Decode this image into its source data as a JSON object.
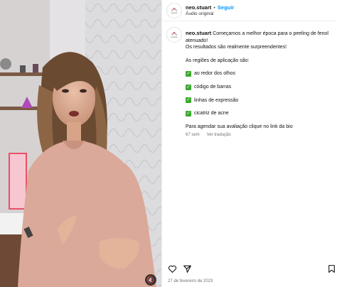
{
  "header": {
    "username": "neo.stuart",
    "separator": "•",
    "follow_label": "Seguir",
    "audio_label": "Áudio original"
  },
  "caption": {
    "username": "neo.stuart",
    "text": "Começamos a melhor época para o peeling de fenol atenuado!",
    "line2": "Os resultados são realmente surpreendentes!",
    "regions_intro": "As regiões de aplicação são:",
    "items": [
      "ao redor dos olhos",
      "código de barras",
      "linhas de expressão",
      "cicatriz de acne"
    ],
    "cta": "Para agendar sua avaliação clique no link da bio",
    "check_symbol": "✓"
  },
  "meta": {
    "age": "67 sem",
    "translate_label": "Ver tradução"
  },
  "date": "27 de fevereiro de 2023",
  "icons": {
    "like": "heart-icon",
    "share": "share-icon",
    "save": "bookmark-icon",
    "mute": "speaker-muted-icon"
  },
  "mute_symbol": "🔇",
  "colors": {
    "follow": "#0095f6",
    "check": "#3ea832",
    "meta": "#737373"
  }
}
